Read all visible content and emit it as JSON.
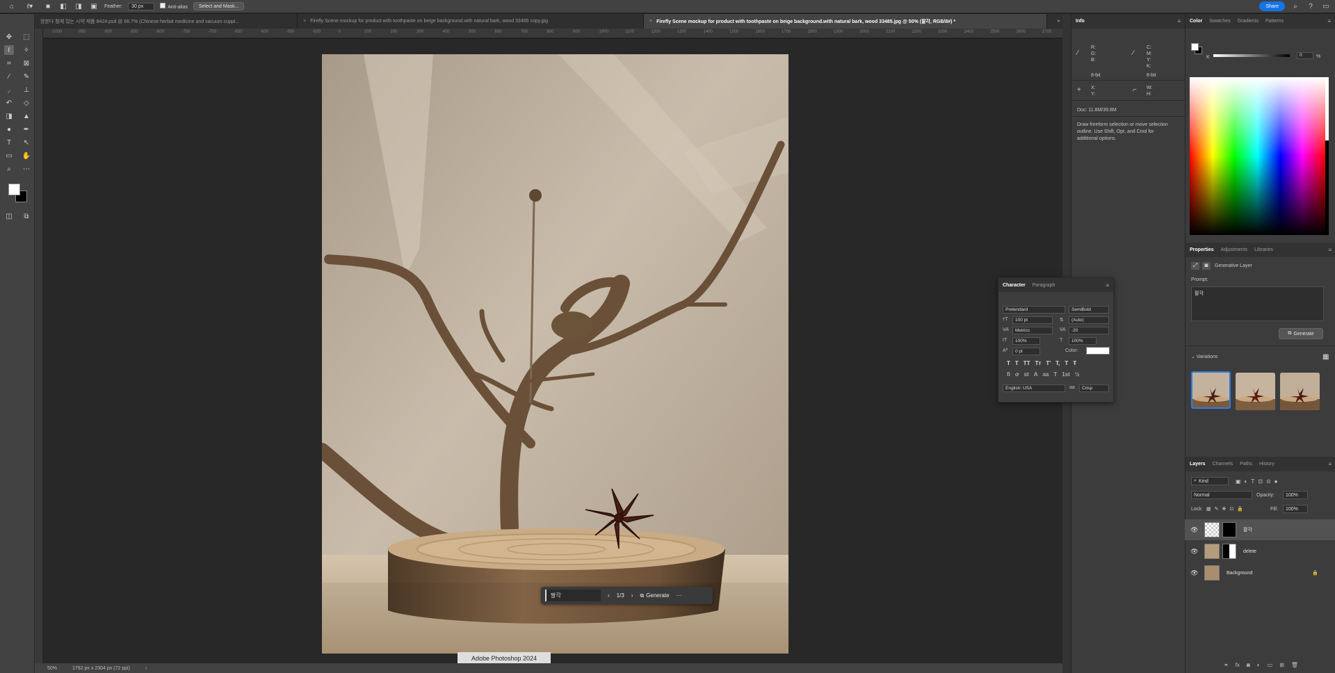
{
  "options_bar": {
    "feather_label": "Feather:",
    "feather_value": "30 px",
    "anti_alias_label": "Anti-alias",
    "select_mask_label": "Select and Mask...",
    "share_label": "Share"
  },
  "tabs": [
    {
      "label": "양본다 함께 있는 시약 제품 8424.psd @ 66.7% (Chinese herbal medicine and vacuum cuppi..."
    },
    {
      "label": "Firefly Scene mockup for product with toothpaste on beige background.with natural bark, wood 33485 copy.jpg"
    },
    {
      "label": "Firefly Scene mockup for product with toothpaste on beige background.with natural bark, wood 33485.jpg @ 50% (팔각, RGB/8#) *"
    }
  ],
  "ruler_ticks": [
    "-1000",
    "-950",
    "-900",
    "-850",
    "-800",
    "-750",
    "-700",
    "-650",
    "-600",
    "-550",
    "-500",
    "0",
    "100",
    "200",
    "300",
    "400",
    "500",
    "600",
    "700",
    "800",
    "900",
    "1000",
    "1100",
    "1200",
    "1300",
    "1400",
    "1500",
    "1600",
    "1700",
    "1800",
    "1900",
    "2000",
    "2100",
    "2200",
    "2300",
    "2400",
    "2500",
    "2600",
    "2700"
  ],
  "generative_toolbar": {
    "prompt": "팔각",
    "counter": "1/3",
    "generate_label": "Generate",
    "more": "···"
  },
  "tooltip": "Adobe Photoshop 2024",
  "status": {
    "zoom": "50%",
    "doc_size": "1792 px x 2304 px (72 ppi)"
  },
  "info_panel": {
    "title": "Info",
    "rgb_labels": "R:\nG:\nB:",
    "cmyk_labels": "C:\nM:\nY:\nK:",
    "bit_left": "8-bit",
    "bit_right": "8-bit",
    "xy_labels": "X:\nY:",
    "wh_labels": "W:\nH:",
    "doc": "Doc: 11.8M/39.8M",
    "hint": "Draw freeform selection or move selection outline.  Use Shift, Opt, and Cmd for additional options."
  },
  "color_panel": {
    "tabs": [
      "Color",
      "Swatches",
      "Gradients",
      "Patterns"
    ],
    "k_label": "K",
    "k_value": "0",
    "pct": "%"
  },
  "properties_panel": {
    "tabs": [
      "Properties",
      "Adjustments",
      "Libraries"
    ],
    "layer_type": "Generative Layer",
    "prompt_label": "Prompt:",
    "prompt_value": "팔각",
    "generate_label": "Generate",
    "variations_label": "Variations"
  },
  "character_panel": {
    "tabs": [
      "Character",
      "Paragraph"
    ],
    "font_family": "Pretendard",
    "font_style": "SemiBold",
    "size": "100 pt",
    "leading": "(Auto)",
    "kerning": "Metrics",
    "tracking": "-20",
    "vscale": "100%",
    "hscale": "100%",
    "baseline": "0 pt",
    "color_label": "Color:",
    "style_glyphs": [
      "T",
      "T",
      "TT",
      "Tт",
      "T'",
      "T,",
      "T",
      "Ŧ"
    ],
    "ot_glyphs": [
      "fi",
      "ơ",
      "st",
      "A",
      "aa",
      "T",
      "1st",
      "½"
    ],
    "language": "English: USA",
    "aa_label": "aa",
    "aa_value": "Crisp"
  },
  "layers_panel": {
    "tabs": [
      "Layers",
      "Channels",
      "Paths",
      "History"
    ],
    "filter": "Kind",
    "blend_mode": "Normal",
    "opacity_label": "Opacity:",
    "opacity_value": "100%",
    "lock_label": "Lock:",
    "fill_label": "Fill:",
    "fill_value": "100%",
    "layers": [
      {
        "name": "팔각",
        "selected": true
      },
      {
        "name": "delete",
        "selected": false
      },
      {
        "name": "Background",
        "selected": false
      }
    ]
  }
}
